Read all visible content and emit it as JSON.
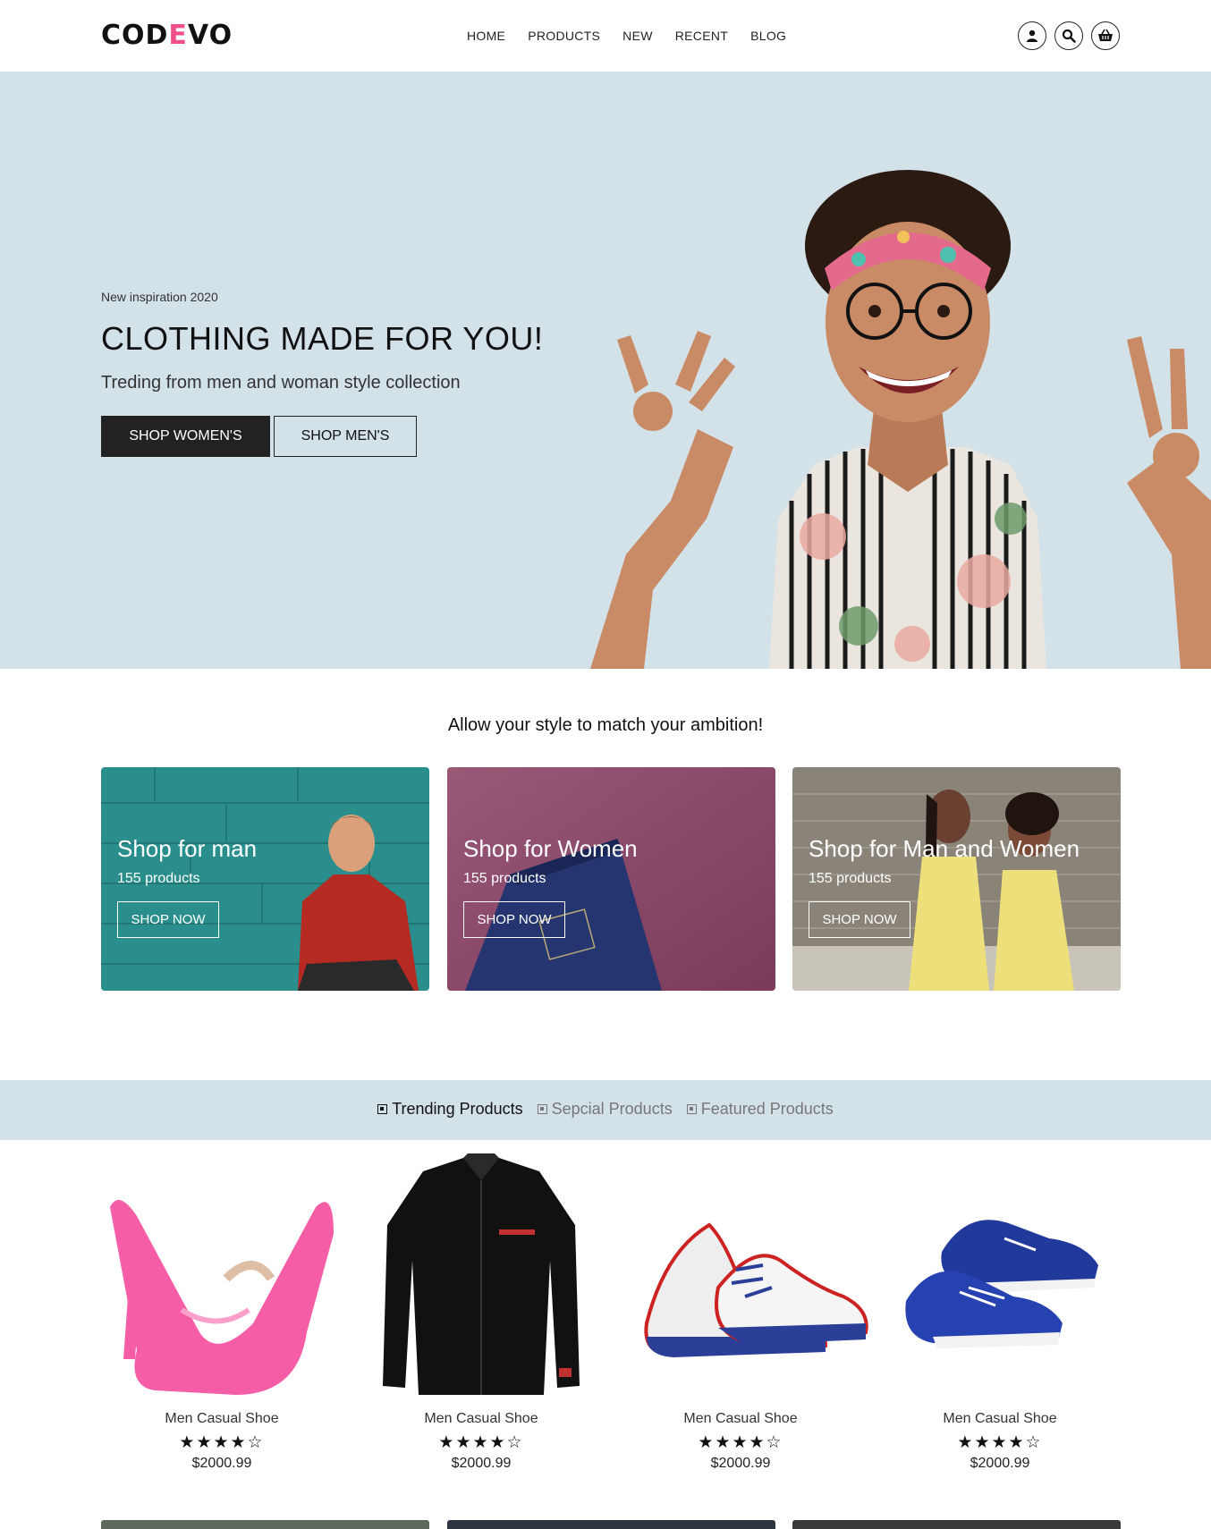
{
  "header": {
    "logo_pre": "COD",
    "logo_accent": "E",
    "logo_post": "VO",
    "nav": [
      "HOME",
      "PRODUCTS",
      "NEW",
      "RECENT",
      "BLOG"
    ],
    "icons": [
      "user-icon",
      "search-icon",
      "basket-icon"
    ]
  },
  "hero": {
    "eyebrow": "New inspiration 2020",
    "title": "CLOTHING MADE FOR YOU!",
    "subtitle": "Treding from men and woman style collection",
    "btn_women": "SHOP WOMEN'S",
    "btn_men": "SHOP MEN'S",
    "bg_color": "#d3e1e8"
  },
  "ambition": {
    "title": "Allow your style to match your ambition!",
    "cards": [
      {
        "title": "Shop for man",
        "count": "155 products",
        "cta": "SHOP NOW",
        "color": "#2a8f8c"
      },
      {
        "title": "Shop for Women",
        "count": "155 products",
        "cta": "SHOP NOW",
        "color": "#8e4a6a"
      },
      {
        "title": "Shop for Man and Women",
        "count": "155 products",
        "cta": "SHOP NOW",
        "color": "#8a8478"
      }
    ]
  },
  "tabs": [
    {
      "label": "Trending Products",
      "active": true
    },
    {
      "label": "Sepcial Products",
      "active": false
    },
    {
      "label": "Featured Products",
      "active": false
    }
  ],
  "products": [
    {
      "name": "Men Casual Shoe",
      "rating": 4,
      "stars": "★★★★☆",
      "price": "$2000.99",
      "image": "pink-heels"
    },
    {
      "name": "Men Casual Shoe",
      "rating": 4,
      "stars": "★★★★☆",
      "price": "$2000.99",
      "image": "black-shirt"
    },
    {
      "name": "Men Casual Shoe",
      "rating": 4,
      "stars": "★★★★☆",
      "price": "$2000.99",
      "image": "sneakers"
    },
    {
      "name": "Men Casual Shoe",
      "rating": 4,
      "stars": "★★★★☆",
      "price": "$2000.99",
      "image": "blue-boat-shoes"
    }
  ],
  "colors": {
    "accent": "#f0508a",
    "dark": "#222222",
    "hero_bg": "#d3e1e8"
  }
}
